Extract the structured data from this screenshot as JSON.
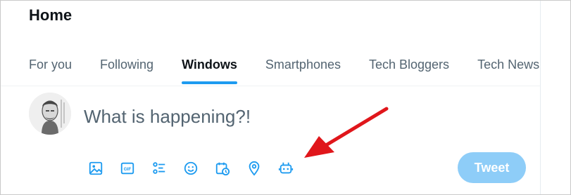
{
  "header": {
    "title": "Home"
  },
  "tabs": [
    {
      "label": "For you",
      "active": false
    },
    {
      "label": "Following",
      "active": false
    },
    {
      "label": "Windows",
      "active": true
    },
    {
      "label": "Smartphones",
      "active": false
    },
    {
      "label": "Tech Bloggers",
      "active": false
    },
    {
      "label": "Tech News",
      "active": false
    }
  ],
  "composer": {
    "placeholder": "What is happening?!",
    "tweet_label": "Tweet"
  },
  "toolbar": {
    "icons": [
      "image-icon",
      "gif-icon",
      "poll-icon",
      "emoji-icon",
      "schedule-icon",
      "location-icon",
      "grok-bot-icon"
    ]
  },
  "colors": {
    "accent": "#1d9bf0",
    "tweet_disabled": "#8ecdf8",
    "annotation_arrow": "#e0161b"
  }
}
